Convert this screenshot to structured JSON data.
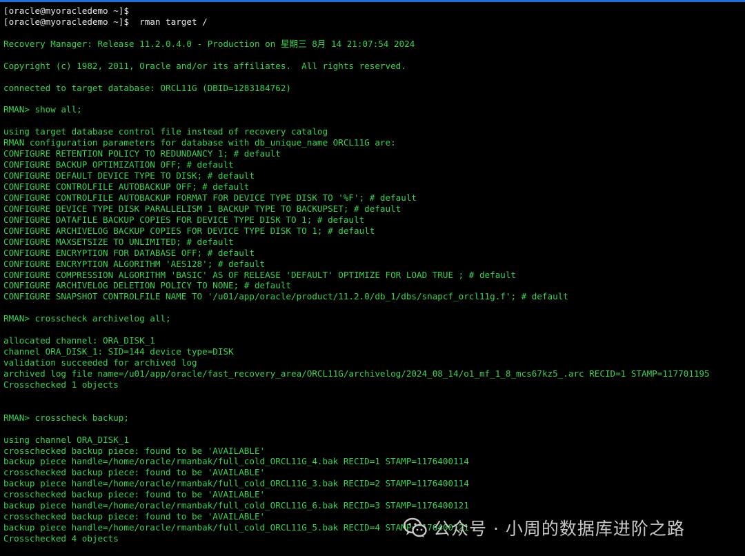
{
  "terminal": {
    "lines": [
      {
        "text": "[oracle@myoracledemo ~]$",
        "style": "prompt"
      },
      {
        "text": "[oracle@myoracledemo ~]$  rman target /",
        "style": "prompt"
      },
      {
        "text": "",
        "style": "blank"
      },
      {
        "text": "Recovery Manager: Release 11.2.0.4.0 - Production on 星期三 8月 14 21:07:54 2024",
        "style": "out"
      },
      {
        "text": "",
        "style": "blank"
      },
      {
        "text": "Copyright (c) 1982, 2011, Oracle and/or its affiliates.  All rights reserved.",
        "style": "out"
      },
      {
        "text": "",
        "style": "blank"
      },
      {
        "text": "connected to target database: ORCL11G (DBID=1283184762)",
        "style": "out"
      },
      {
        "text": "",
        "style": "blank"
      },
      {
        "text": "RMAN> show all;",
        "style": "out"
      },
      {
        "text": "",
        "style": "blank"
      },
      {
        "text": "using target database control file instead of recovery catalog",
        "style": "out"
      },
      {
        "text": "RMAN configuration parameters for database with db_unique_name ORCL11G are:",
        "style": "out"
      },
      {
        "text": "CONFIGURE RETENTION POLICY TO REDUNDANCY 1; # default",
        "style": "out"
      },
      {
        "text": "CONFIGURE BACKUP OPTIMIZATION OFF; # default",
        "style": "out"
      },
      {
        "text": "CONFIGURE DEFAULT DEVICE TYPE TO DISK; # default",
        "style": "out"
      },
      {
        "text": "CONFIGURE CONTROLFILE AUTOBACKUP OFF; # default",
        "style": "out"
      },
      {
        "text": "CONFIGURE CONTROLFILE AUTOBACKUP FORMAT FOR DEVICE TYPE DISK TO '%F'; # default",
        "style": "out"
      },
      {
        "text": "CONFIGURE DEVICE TYPE DISK PARALLELISM 1 BACKUP TYPE TO BACKUPSET; # default",
        "style": "out"
      },
      {
        "text": "CONFIGURE DATAFILE BACKUP COPIES FOR DEVICE TYPE DISK TO 1; # default",
        "style": "out"
      },
      {
        "text": "CONFIGURE ARCHIVELOG BACKUP COPIES FOR DEVICE TYPE DISK TO 1; # default",
        "style": "out"
      },
      {
        "text": "CONFIGURE MAXSETSIZE TO UNLIMITED; # default",
        "style": "out"
      },
      {
        "text": "CONFIGURE ENCRYPTION FOR DATABASE OFF; # default",
        "style": "out"
      },
      {
        "text": "CONFIGURE ENCRYPTION ALGORITHM 'AES128'; # default",
        "style": "out"
      },
      {
        "text": "CONFIGURE COMPRESSION ALGORITHM 'BASIC' AS OF RELEASE 'DEFAULT' OPTIMIZE FOR LOAD TRUE ; # default",
        "style": "out"
      },
      {
        "text": "CONFIGURE ARCHIVELOG DELETION POLICY TO NONE; # default",
        "style": "out"
      },
      {
        "text": "CONFIGURE SNAPSHOT CONTROLFILE NAME TO '/u01/app/oracle/product/11.2.0/db_1/dbs/snapcf_orcl11g.f'; # default",
        "style": "out"
      },
      {
        "text": "",
        "style": "blank"
      },
      {
        "text": "RMAN> crosscheck archivelog all;",
        "style": "out"
      },
      {
        "text": "",
        "style": "blank"
      },
      {
        "text": "allocated channel: ORA_DISK_1",
        "style": "out"
      },
      {
        "text": "channel ORA_DISK_1: SID=144 device type=DISK",
        "style": "out"
      },
      {
        "text": "validation succeeded for archived log",
        "style": "out"
      },
      {
        "text": "archived log file name=/u01/app/oracle/fast_recovery_area/ORCL11G/archivelog/2024_08_14/o1_mf_1_8_mcs67kz5_.arc RECID=1 STAMP=117701195",
        "style": "out"
      },
      {
        "text": "Crosschecked 1 objects",
        "style": "out"
      },
      {
        "text": "",
        "style": "blank"
      },
      {
        "text": "",
        "style": "blank"
      },
      {
        "text": "RMAN> crosscheck backup;",
        "style": "out"
      },
      {
        "text": "",
        "style": "blank"
      },
      {
        "text": "using channel ORA_DISK_1",
        "style": "out"
      },
      {
        "text": "crosschecked backup piece: found to be 'AVAILABLE'",
        "style": "out"
      },
      {
        "text": "backup piece handle=/home/oracle/rmanbak/full_cold_ORCL11G_4.bak RECID=1 STAMP=1176400114",
        "style": "out"
      },
      {
        "text": "crosschecked backup piece: found to be 'AVAILABLE'",
        "style": "out"
      },
      {
        "text": "backup piece handle=/home/oracle/rmanbak/full_cold_ORCL11G_3.bak RECID=2 STAMP=1176400114",
        "style": "out"
      },
      {
        "text": "crosschecked backup piece: found to be 'AVAILABLE'",
        "style": "out"
      },
      {
        "text": "backup piece handle=/home/oracle/rmanbak/full_cold_ORCL11G_6.bak RECID=3 STAMP=1176400121",
        "style": "out"
      },
      {
        "text": "crosschecked backup piece: found to be 'AVAILABLE'",
        "style": "out"
      },
      {
        "text": "backup piece handle=/home/oracle/rmanbak/full_cold_ORCL11G_5.bak RECID=4 STAMP=1176400121",
        "style": "out"
      },
      {
        "text": "Crosschecked 4 objects",
        "style": "out"
      }
    ]
  },
  "watermark": {
    "icon": "wechat-icon",
    "text": "公众号 · 小周的数据库进阶之路"
  },
  "colors": {
    "background": "#000000",
    "prompt_text": "#e8e8e8",
    "output_text": "#39d353",
    "top_border": "#1e6fd9",
    "watermark": "#d9d9d9"
  }
}
